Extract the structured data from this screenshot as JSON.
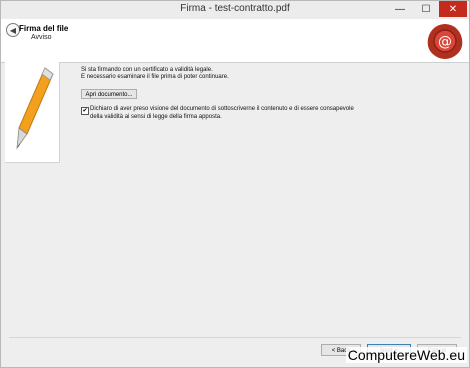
{
  "window": {
    "title": "Firma - test-contratto.pdf",
    "controls": {
      "minimize": "—",
      "maximize": "☐",
      "close": "✕"
    }
  },
  "header": {
    "title": "Firma del file",
    "subtitle": "Avviso",
    "back_icon": "arrow-left-icon",
    "logo_icon": "wax-seal-icon",
    "logo_color": "#c0392b"
  },
  "content": {
    "lines": [
      "Si sta firmando con un certificato a validità legale.",
      "E necessario esaminare il file prima di poter continuare."
    ],
    "open_document_button": "Apri documento...",
    "checkbox": {
      "checked": true,
      "label": "Dichiaro di aver preso visione del documento di sottoscriverne il contenuto e di essere consapevole della validità ai sensi di legge della firma apposta."
    }
  },
  "footer": {
    "back_button": "< Back",
    "next_button": "Next >",
    "cancel_button": "Cancel"
  },
  "watermark": "ComputereWeb.eu"
}
